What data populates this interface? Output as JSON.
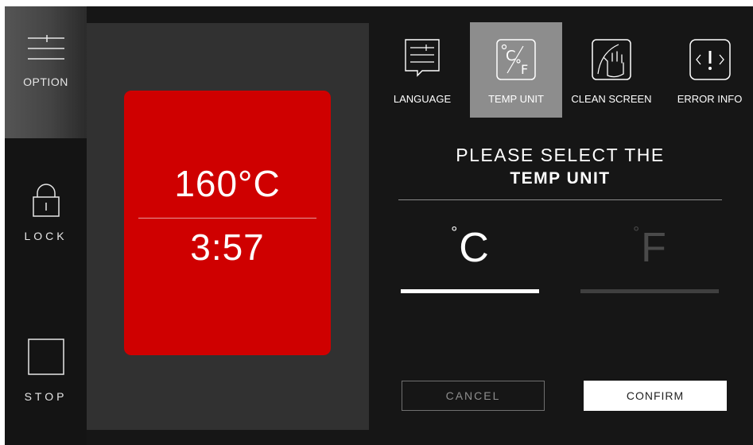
{
  "rail": {
    "option_label": "OPTION",
    "lock_label": "LOCK",
    "stop_label": "STOP"
  },
  "display": {
    "temperature": "160°C",
    "time": "3:57",
    "card_color": "#cf0000"
  },
  "tabs": [
    {
      "label": "LANGUAGE",
      "icon": "language-icon",
      "selected": false
    },
    {
      "label": "TEMP UNIT",
      "icon": "temp-unit-icon",
      "selected": true
    },
    {
      "label": "CLEAN SCREEN",
      "icon": "clean-screen-icon",
      "selected": false
    },
    {
      "label": "ERROR INFO",
      "icon": "error-info-icon",
      "selected": false
    }
  ],
  "prompt": {
    "line1": "PLEASE SELECT THE",
    "line2": "TEMP UNIT"
  },
  "units": {
    "celsius": {
      "degree": "°",
      "letter": "C",
      "selected": true
    },
    "fahrenheit": {
      "degree": "°",
      "letter": "F",
      "selected": false
    }
  },
  "buttons": {
    "cancel": "CANCEL",
    "confirm": "CONFIRM"
  },
  "colors": {
    "background": "#161616",
    "selected_tab": "#8d8d8d",
    "accent": "#cf0000"
  }
}
